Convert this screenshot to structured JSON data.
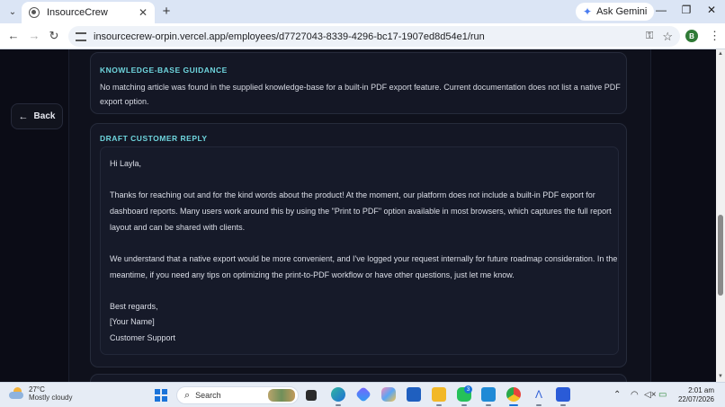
{
  "browser": {
    "tab_title": "InsourceCrew",
    "ask_gemini": "Ask Gemini",
    "url_host": "insourcecrew-orpin.vercel.app",
    "url_path": "/employees/d7727043-8339-4296-bc17-1907ed8d54e1/run",
    "profile_initial": "B"
  },
  "page": {
    "back_label": "Back",
    "kb_section": {
      "label": "KNOWLEDGE-BASE GUIDANCE",
      "text": "No matching article was found in the supplied knowledge-base for a built-in PDF export feature. Current documentation does not list a native PDF export option."
    },
    "draft_section": {
      "label": "DRAFT CUSTOMER REPLY",
      "lines": [
        "Hi Layla,",
        "Thanks for reaching out and for the kind words about the product! At the moment, our platform does not include a built-in PDF export for",
        "dashboard reports. Many users work around this by using the \"Print to PDF\" option available in most browsers, which captures the full report",
        "layout and can be shared with clients.",
        "We understand that a native export would be more convenient, and I've logged your request internally for future roadmap consideration. In the",
        "meantime, if you need any tips on optimizing the print-to-PDF workflow or have other questions, just let me know.",
        "Best regards,",
        "[Your Name]",
        "Customer Support"
      ]
    }
  },
  "taskbar": {
    "temperature": "27°C",
    "condition": "Mostly cloudy",
    "search_label": "Search",
    "whatsapp_badge": "3",
    "time": "2:01 am",
    "date": "22/07/2026"
  },
  "icons": {
    "browser_tab": "globe-icon",
    "back": "arrow-left-icon",
    "search": "search-icon",
    "start": "windows-logo-icon"
  }
}
